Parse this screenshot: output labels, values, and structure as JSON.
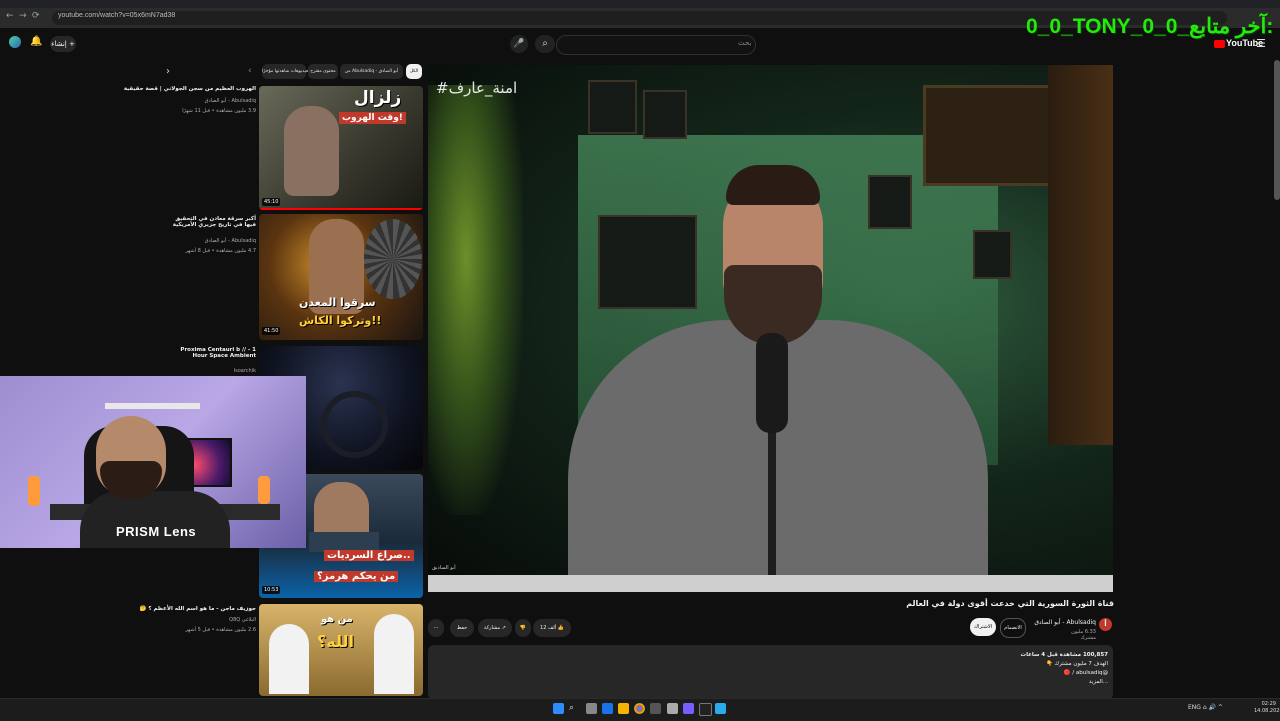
{
  "browser": {
    "url": "youtube.com/watch?v=05x6mN7ad38"
  },
  "overlay": {
    "title": "0_0_TONY_0_0_آخر متابع:"
  },
  "header": {
    "logo_text": "YouTube",
    "search_placeholder": "بحث",
    "create_label": "إنشاء",
    "hamburger": "☰",
    "mic": "🎤",
    "search_icon": "⌕",
    "bell": "🔔"
  },
  "player": {
    "hashtag": "#امنة_عارف",
    "watermark": "أبو الساديق"
  },
  "video": {
    "title": "قناة الثورة السورية التي خدعت أقوى دولة في العالم",
    "channel_name": "Abulsadiq - أبو الصادق",
    "channel_initial": "أ",
    "subscribers": "6.33 مليون مشترك",
    "join_label": "الانضمام",
    "subscribe_label": "الاشتراك",
    "like_count": "12 ألف",
    "share_label": "مشاركة",
    "save_label": "حفظ",
    "more_label": "⋯",
    "description": {
      "views": "100,857 مشاهدة قبل 4 ساعات",
      "line2": "الهدف 7 مليون مشترك 👇",
      "line3": "@abulsadiq / 🔴",
      "line4": "...المزيد"
    }
  },
  "chips": [
    "من Abulsadiq - أبو الصادق",
    "محتوى مقترح",
    "فيديوهات شاهدتها مؤخرًا",
    "الكل"
  ],
  "related": [
    {
      "title": "الهروب العظيم من سجن الجولاني | قصة حقيقية",
      "channel": "Abulsadiq - أبو الصادق",
      "meta": "3.9 مليون مشاهدة • قبل 11 شهرًا",
      "duration": "45:10",
      "thumb_text1": "زلزال",
      "thumb_text2": "وقت الهروب!"
    },
    {
      "title": "أكبر سرقة معادن في التحقيق فيها في تاريخ جزيري الأمريكية",
      "channel": "Abulsadiq - أبو الصادق",
      "meta": "4.7 مليون مشاهدة • قبل 8 أشهر",
      "duration": "41:50",
      "thumb_text1": "سرقوا المعدن",
      "thumb_text2": "وتركوا الكاش!!"
    },
    {
      "title": "Proxima Centauri b // - 1 Hour Space Ambient",
      "channel": "Isoarchik",
      "meta": "",
      "duration": ""
    },
    {
      "title": "",
      "channel": "",
      "meta": "",
      "duration": "10:53",
      "thumb_text1": "صراع السرديات..",
      "thumb_text2": "من يحكم هرمز؟"
    },
    {
      "title": "جوزيف ماجن - ما هو اسم الله الأعظم ؟ 🤔",
      "channel": "البلاغي Q8Q",
      "meta": "2.6 مليون مشاهدة • قبل 5 أشهر",
      "duration": "",
      "thumb_text1": "من هو",
      "thumb_text2": "الله؟"
    }
  ],
  "webcam": {
    "label": "PRISM Lens"
  },
  "taskbar": {
    "tray": "ENG ⌂ 🔊 ^",
    "time": "02:29",
    "date": "14.08.2026"
  }
}
